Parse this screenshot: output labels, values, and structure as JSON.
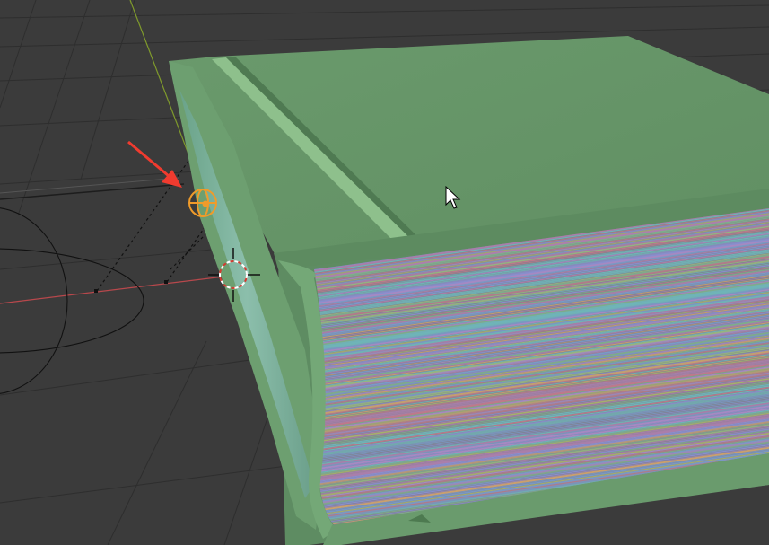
{
  "viewport": {
    "name": "3D Viewport",
    "background": "#3b3b3b",
    "grid_color": "#2d2d2d",
    "x_axis_color": "#b8484c",
    "y_axis_color": "#7f9a2c"
  },
  "scene": {
    "object": "book",
    "cover_color": "#67976a",
    "cover_highlight": "#7fae80",
    "spine_color": "#7fb0a0",
    "pages": "multicolor-stripes"
  },
  "overlays": {
    "selected_object_origin": "orange-sphere-gizmo",
    "selected_color": "#ef9b2a",
    "cursor_3d": "3d-cursor",
    "annotation_arrow_color": "#f03b2f",
    "mouse_pointer": "arrow-cursor"
  }
}
